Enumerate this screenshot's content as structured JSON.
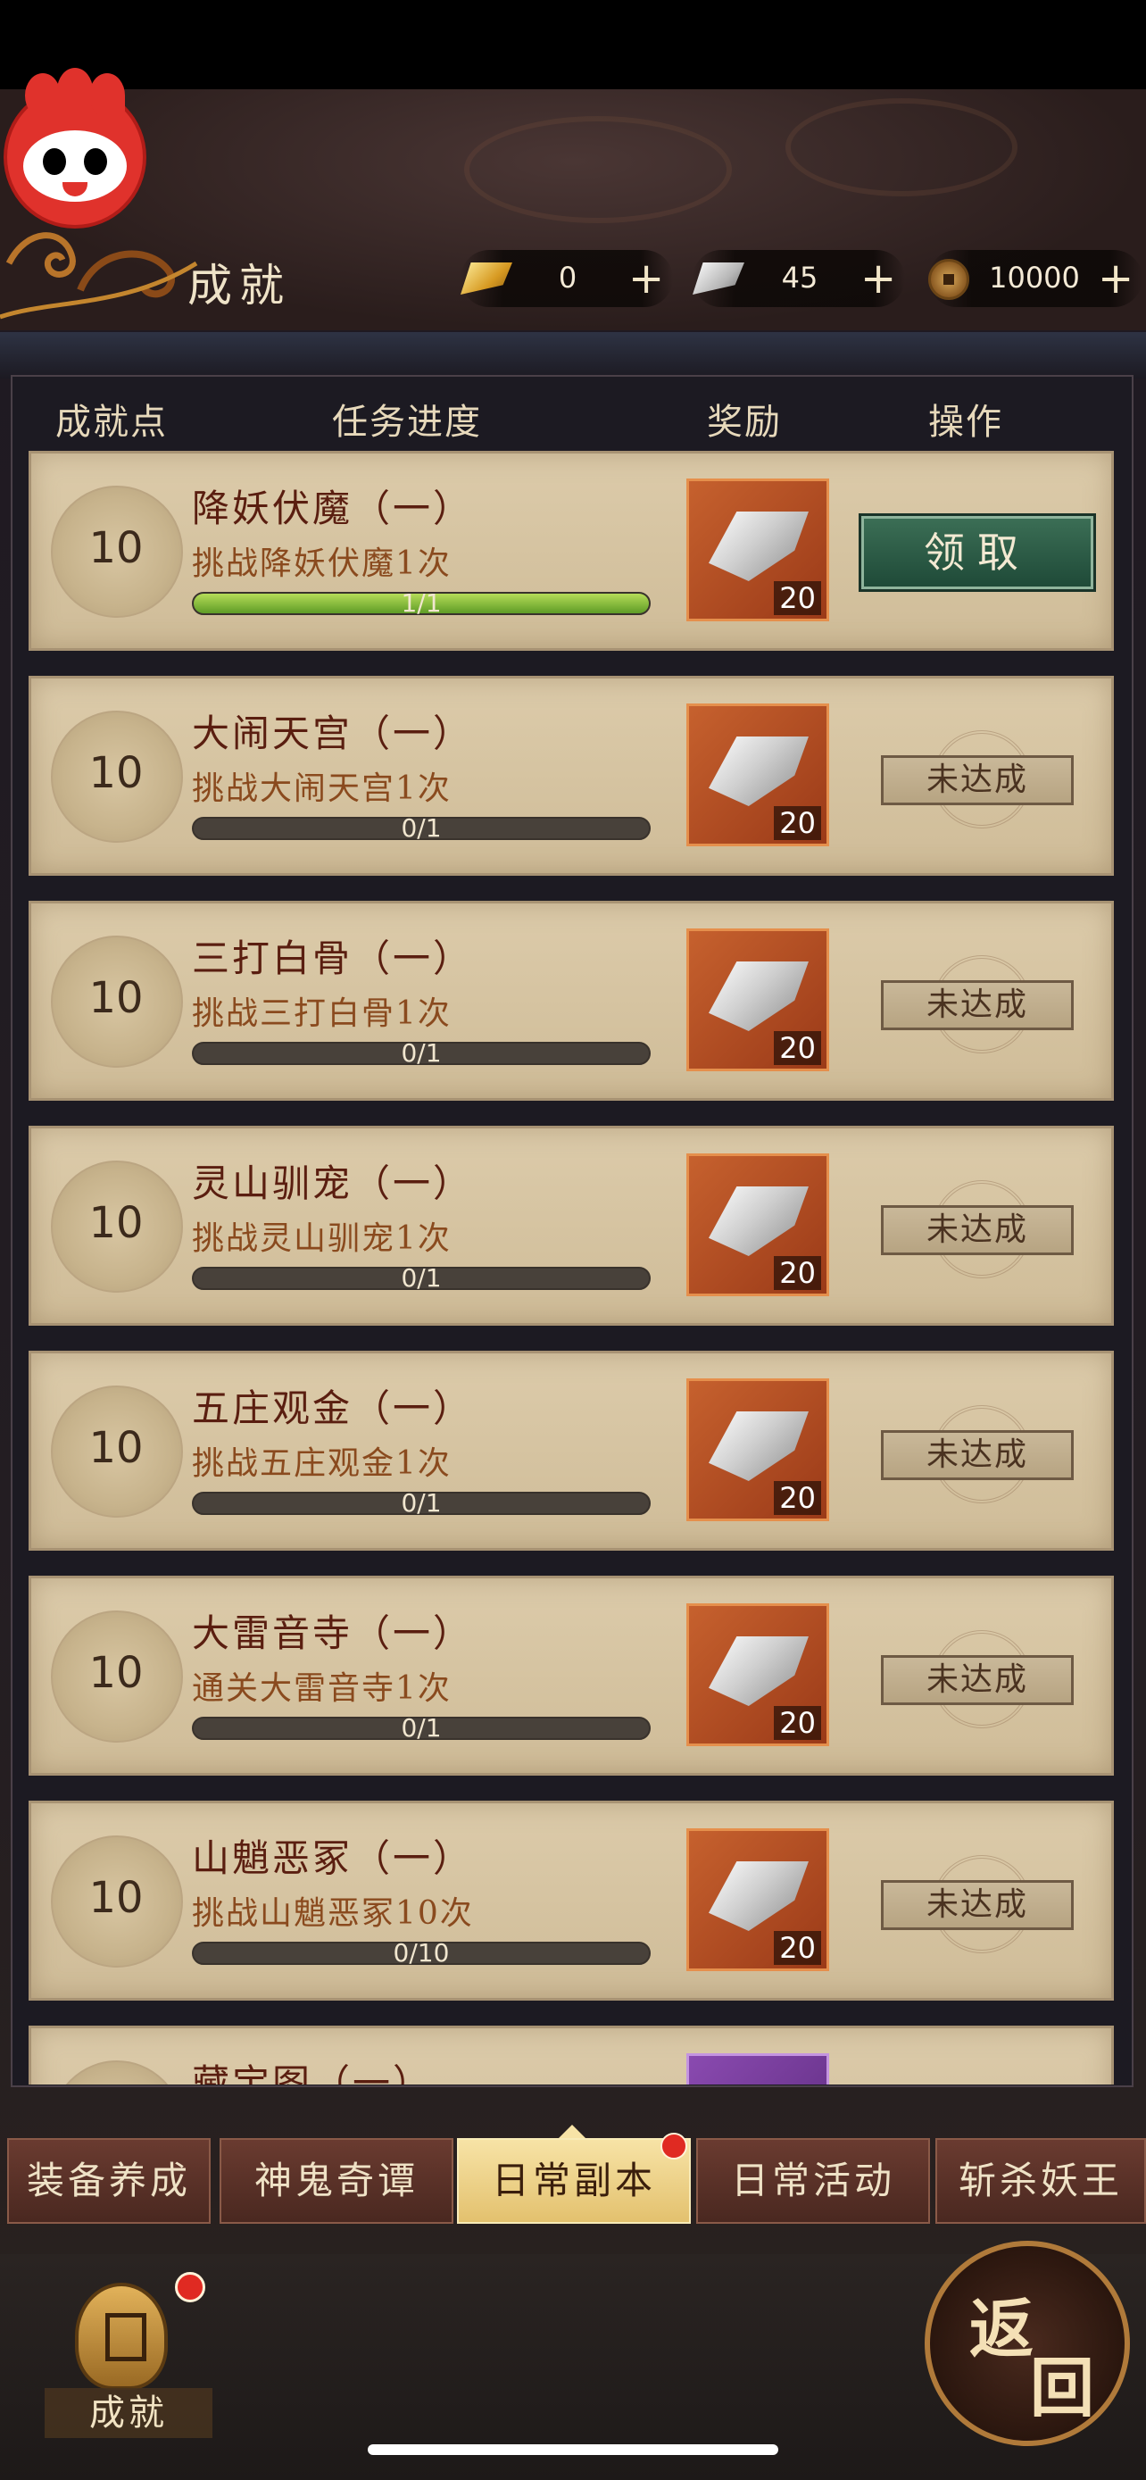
{
  "header": {
    "title": "成就",
    "resources": [
      {
        "icon": "gold-ingot-icon",
        "value": "0",
        "plus": "+"
      },
      {
        "icon": "silver-ingot-icon",
        "value": "45",
        "plus": "+"
      },
      {
        "icon": "copper-coin-icon",
        "value": "10000",
        "plus": "+"
      }
    ]
  },
  "columns": [
    "成就点",
    "任务进度",
    "奖励",
    "操作"
  ],
  "achievements": [
    {
      "points": "10",
      "name": "降妖伏魔（一）",
      "desc": "挑战降妖伏魔1次",
      "progress_text": "1/1",
      "progress": 1.0,
      "reward_qty": "20",
      "action": "领取",
      "claimable": true
    },
    {
      "points": "10",
      "name": "大闹天宫（一）",
      "desc": "挑战大闹天宫1次",
      "progress_text": "0/1",
      "progress": 0.0,
      "reward_qty": "20",
      "action": "未达成",
      "claimable": false
    },
    {
      "points": "10",
      "name": "三打白骨（一）",
      "desc": "挑战三打白骨1次",
      "progress_text": "0/1",
      "progress": 0.0,
      "reward_qty": "20",
      "action": "未达成",
      "claimable": false
    },
    {
      "points": "10",
      "name": "灵山驯宠（一）",
      "desc": "挑战灵山驯宠1次",
      "progress_text": "0/1",
      "progress": 0.0,
      "reward_qty": "20",
      "action": "未达成",
      "claimable": false
    },
    {
      "points": "10",
      "name": "五庄观金（一）",
      "desc": "挑战五庄观金1次",
      "progress_text": "0/1",
      "progress": 0.0,
      "reward_qty": "20",
      "action": "未达成",
      "claimable": false
    },
    {
      "points": "10",
      "name": "大雷音寺（一）",
      "desc": "通关大雷音寺1次",
      "progress_text": "0/1",
      "progress": 0.0,
      "reward_qty": "20",
      "action": "未达成",
      "claimable": false
    },
    {
      "points": "10",
      "name": "山魈恶冢（一）",
      "desc": "挑战山魈恶冢10次",
      "progress_text": "0/10",
      "progress": 0.0,
      "reward_qty": "20",
      "action": "未达成",
      "claimable": false
    },
    {
      "points": "",
      "name": "藏宝图（一）",
      "desc": "",
      "progress_text": "",
      "progress": 0.0,
      "reward_qty": "",
      "action": "",
      "claimable": false
    }
  ],
  "tabs": [
    {
      "label": "装备养成",
      "active": false,
      "dot": false
    },
    {
      "label": "神鬼奇谭",
      "active": false,
      "dot": false
    },
    {
      "label": "日常副本",
      "active": true,
      "dot": true
    },
    {
      "label": "日常活动",
      "active": false,
      "dot": false
    },
    {
      "label": "斩杀妖王",
      "active": false,
      "dot": false
    }
  ],
  "bottom": {
    "achievement_label": "成就",
    "back_char1": "返",
    "back_char2": "回"
  }
}
